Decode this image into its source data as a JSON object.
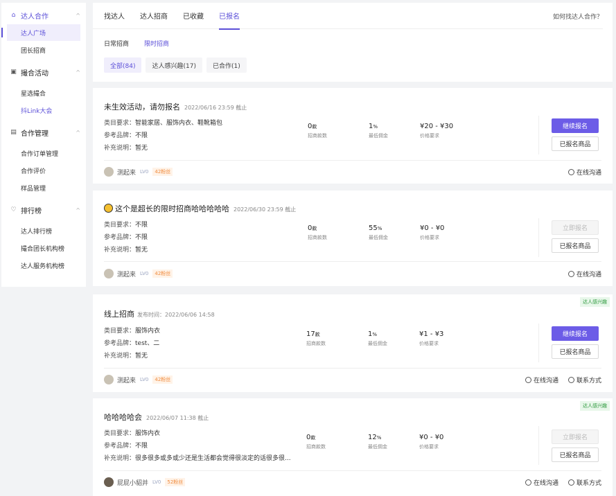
{
  "sidebar": {
    "groups": [
      {
        "label": "达人合作",
        "icon": "home-icon",
        "items": [
          {
            "label": "达人广场"
          },
          {
            "label": "团长招商"
          }
        ]
      },
      {
        "label": "撮合活动",
        "icon": "calendar-icon",
        "items": [
          {
            "label": "星选撮合"
          },
          {
            "label": "抖Link大会"
          }
        ]
      },
      {
        "label": "合作管理",
        "icon": "document-icon",
        "items": [
          {
            "label": "合作订单管理"
          },
          {
            "label": "合作评价"
          },
          {
            "label": "样品管理"
          }
        ]
      },
      {
        "label": "排行榜",
        "icon": "trophy-icon",
        "items": [
          {
            "label": "达人排行榜"
          },
          {
            "label": "撮合团长机构榜"
          },
          {
            "label": "达人服务机构榜"
          }
        ]
      }
    ]
  },
  "header": {
    "tabs": [
      {
        "label": "找达人"
      },
      {
        "label": "达人招商"
      },
      {
        "label": "已收藏"
      },
      {
        "label": "已报名"
      }
    ],
    "help_link": "如何找达人合作？",
    "subtabs": [
      {
        "label": "日常招商"
      },
      {
        "label": "限时招商"
      }
    ],
    "filters": [
      {
        "label": "全部(84)"
      },
      {
        "label": "达人感兴趣(17)"
      },
      {
        "label": "已合作(1)"
      }
    ]
  },
  "labels": {
    "category": "类目要求：",
    "brand": "参考品牌：",
    "note": "补充说明：",
    "m_count": "招商款数",
    "m_commission": "最低佣金",
    "m_price": "价格要求",
    "btn_continue": "继续报名",
    "btn_apply_now": "立即报名",
    "btn_signed_goods": "已报名商品",
    "online_chat": "在线沟通",
    "contact": "联系方式",
    "interested_tag": "达人感兴趣"
  },
  "cards": [
    {
      "title": "未生效活动，请勿报名",
      "subtitle": "2022/06/16 23:59 截止",
      "category": "智能家居、服饰内衣、鞋靴箱包",
      "brand": "不限",
      "note": "暂无",
      "count": "0",
      "count_unit": "款",
      "commission": "1",
      "commission_unit": "%",
      "price": "¥20 - ¥30",
      "user": "测起来",
      "level": "LV0",
      "fans": "42粉丝"
    },
    {
      "title": "这个是超长的限时招商哈哈哈哈哈",
      "subtitle": "2022/06/30 23:59 截止",
      "category": "不限",
      "brand": "不限",
      "note": "暂无",
      "count": "0",
      "count_unit": "款",
      "commission": "55",
      "commission_unit": "%",
      "price": "¥0 - ¥0",
      "user": "测起来",
      "level": "LV0",
      "fans": "42粉丝"
    },
    {
      "title": "线上招商",
      "subtitle": "发布时间：2022/06/06 14:58",
      "category": "服饰内衣",
      "brand": "test、二",
      "note": "暂无",
      "count": "17",
      "count_unit": "款",
      "commission": "1",
      "commission_unit": "%",
      "price": "¥1 - ¥3",
      "user": "测起来",
      "level": "LV0",
      "fans": "42粉丝"
    },
    {
      "title": "哈哈哈哈会",
      "subtitle": "2022/06/07 11:38 截止",
      "category": "服饰内衣",
      "brand": "不限",
      "note": "很多很多或多或少还是生活都会觉得很淡定的话很多很...",
      "count": "0",
      "count_unit": "款",
      "commission": "12",
      "commission_unit": "%",
      "price": "¥0 - ¥0",
      "user": "屁屁小貂并",
      "level": "LV0",
      "fans": "52粉丝"
    }
  ],
  "colors": {
    "accent": "#6c5ce7",
    "accent_text": "#5b4fd8",
    "green_tag": "#2e9a3e",
    "fans": "#f08a3c"
  }
}
